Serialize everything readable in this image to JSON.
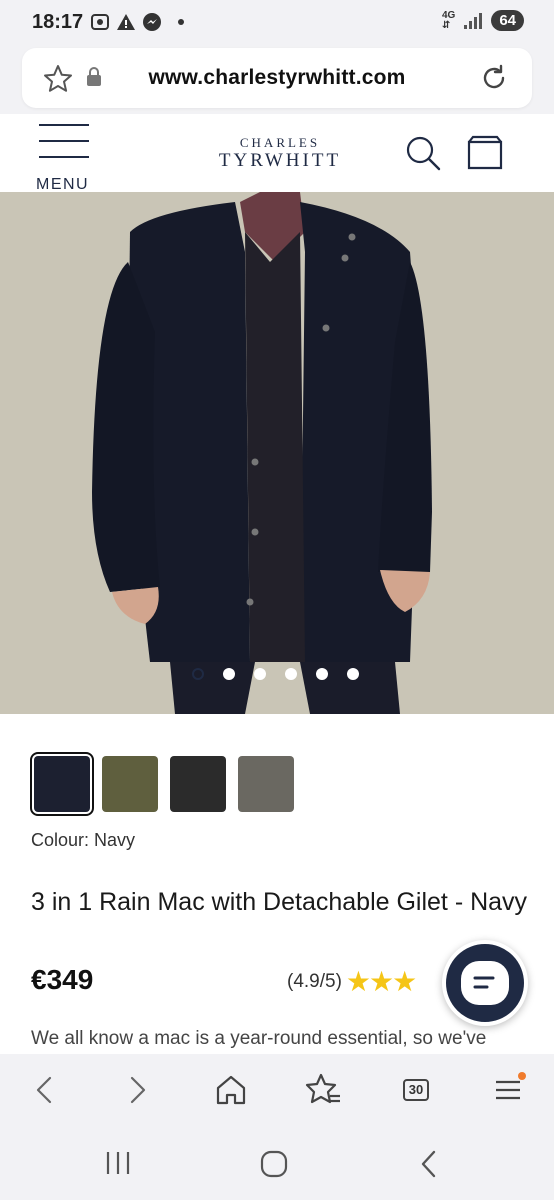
{
  "status": {
    "time": "18:17",
    "network": "4G",
    "battery": "64"
  },
  "browser": {
    "url": "www.charlestyrwhitt.com"
  },
  "site": {
    "menu_label": "MENU",
    "logo_top": "CHARLES",
    "logo_bottom": "TYRWHITT"
  },
  "gallery": {
    "image_count": 6,
    "active_index": 0
  },
  "product": {
    "swatches": [
      {
        "name": "Navy",
        "color": "#1c2030",
        "selected": true
      },
      {
        "name": "Olive",
        "color": "#5f5f3e"
      },
      {
        "name": "Black",
        "color": "#2b2b2b"
      },
      {
        "name": "Grey",
        "color": "#6a6861"
      }
    ],
    "colour_label": "Colour:",
    "colour_value": "Navy",
    "title": "3 in 1 Rain Mac with Detachable Gilet - Navy",
    "price": "€349",
    "rating_text": "(4.9/5)",
    "rating_value": 4.9,
    "stars": "★★★",
    "description": "We all know a mac is a year-round essential, so we've"
  },
  "toolbar": {
    "tabs_count": "30"
  },
  "colors": {
    "brand_navy": "#1f2a44",
    "star": "#f5c517",
    "notification": "#f07b2c"
  }
}
